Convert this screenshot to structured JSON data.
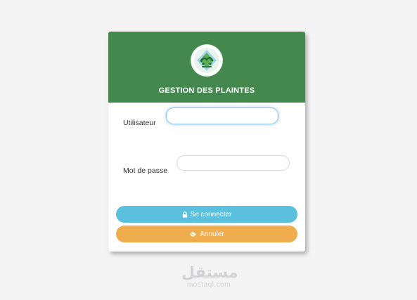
{
  "header": {
    "title": "GESTION DES PLAINTES",
    "logo_icon": "organization-logo",
    "color": "#44884e"
  },
  "form": {
    "user_label": "Utilisateur",
    "user_value": "",
    "pass_label": "Mot de passe",
    "pass_value": ""
  },
  "buttons": {
    "login_label": "Se connecter",
    "login_icon": "lock-icon",
    "login_color": "#5bc0de",
    "cancel_label": "Annuler",
    "cancel_icon": "eraser-icon",
    "cancel_color": "#f0ad4e"
  },
  "watermark": {
    "arabic": "مستقل",
    "latin": "mostaql.com"
  }
}
